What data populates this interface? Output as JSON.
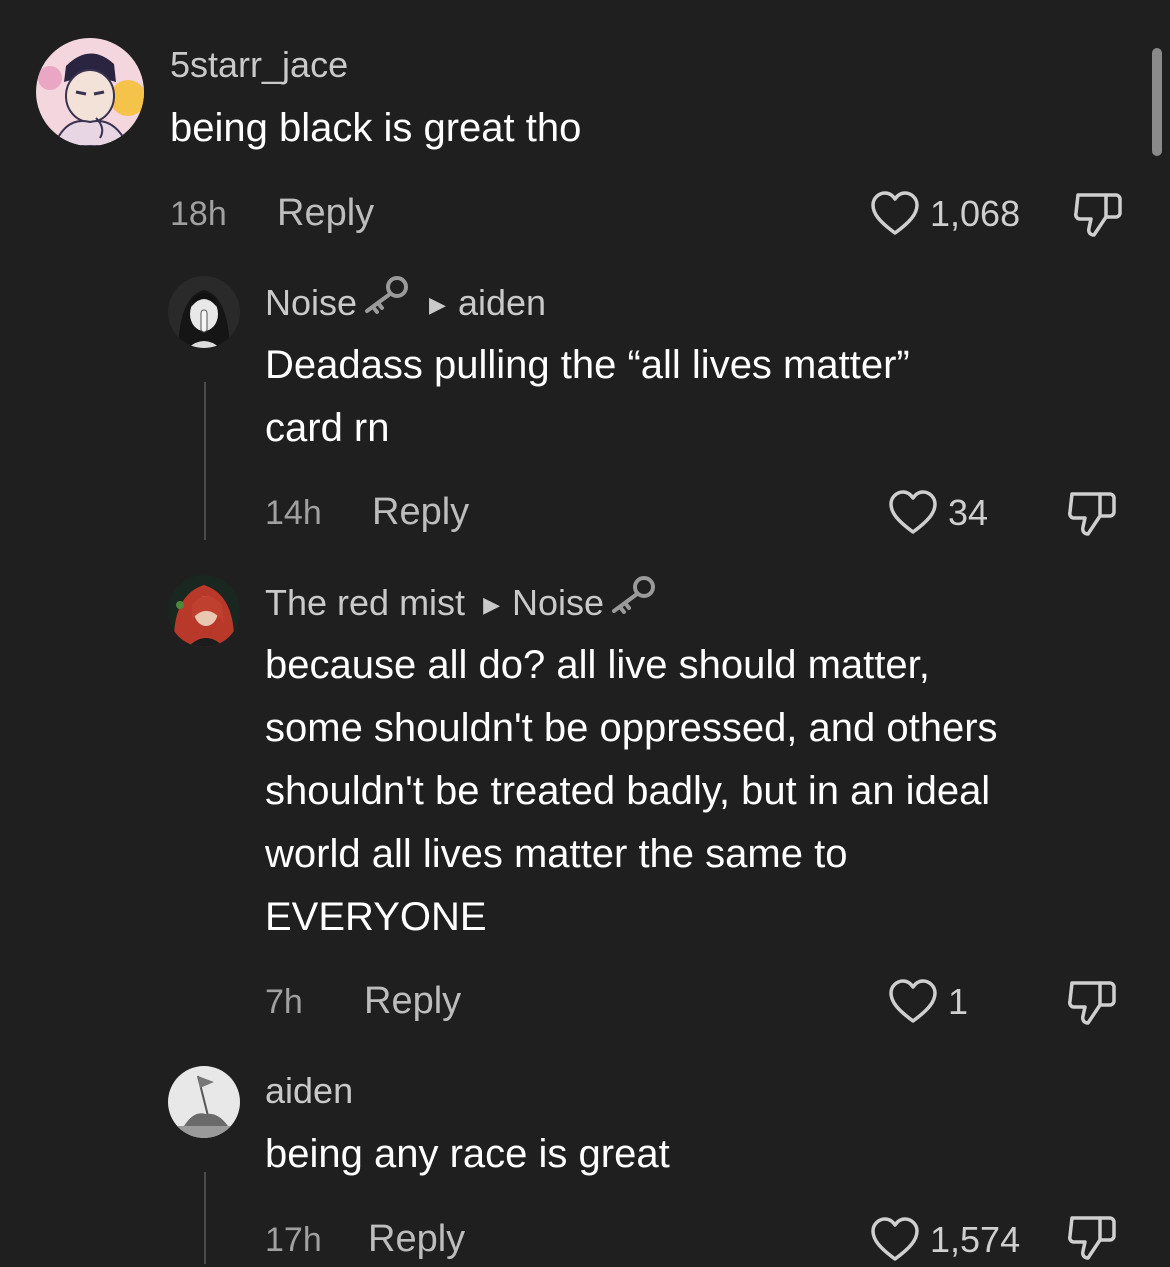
{
  "comments": [
    {
      "username": "5starr_jace",
      "text": "being black is great tho",
      "time": "18h",
      "reply_label": "Reply",
      "likes": "1,068"
    },
    {
      "username": "Noise",
      "reply_to": "aiden",
      "text_line1": "Deadass pulling the “all lives matter”",
      "text_line2": "card rn",
      "time": "14h",
      "reply_label": "Reply",
      "likes": "34"
    },
    {
      "username": "The red mist",
      "reply_to": "Noise",
      "text_line1": "because all do? all live should matter,",
      "text_line2": "some shouldn't be oppressed, and others",
      "text_line3": "shouldn't be treated badly, but in an ideal",
      "text_line4": "world all lives matter the same to",
      "text_line5": "EVERYONE",
      "time": "7h",
      "reply_label": "Reply",
      "likes": "1"
    },
    {
      "username": "aiden",
      "text": "being any race is great",
      "time": "17h",
      "reply_label": "Reply",
      "likes": "1,574"
    }
  ],
  "icons": {
    "like": "heart-outline-icon",
    "dislike": "thumbs-down-icon",
    "badge": "key-icon",
    "reply_arrow": "triangle-right-icon"
  },
  "colors": {
    "background": "#1f1f20",
    "text": "#ffffff",
    "muted": "#a0a0a0"
  }
}
